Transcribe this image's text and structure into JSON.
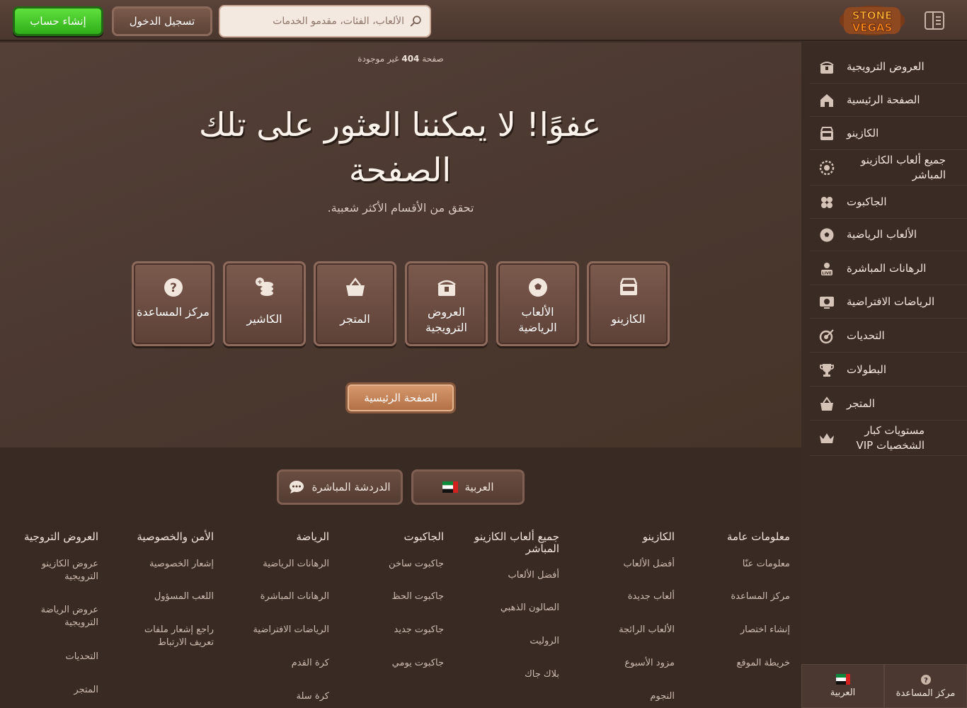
{
  "header": {
    "register_label": "إنشاء حساب",
    "login_label": "تسجيل الدخول",
    "search_placeholder": "الألعاب، الفئات، مقدمو الخدمات",
    "logo_top": "STONE",
    "logo_bottom": "VEGAS"
  },
  "sidebar": {
    "items": [
      {
        "label": "العروض الترويجية",
        "icon": "promotions-chest-icon"
      },
      {
        "label": "الصفحة الرئيسية",
        "icon": "home-icon"
      },
      {
        "label": "الكازينو",
        "icon": "casino-icon"
      },
      {
        "label": "جميع ألعاب الكازينو المباشر",
        "icon": "live-casino-chip-icon"
      },
      {
        "label": "الجاكبوت",
        "icon": "clover-icon"
      },
      {
        "label": "الألعاب الرياضية",
        "icon": "soccer-ball-icon"
      },
      {
        "label": "الرهانات المباشرة",
        "icon": "live-bet-icon"
      },
      {
        "label": "الرياضات الافتراضية",
        "icon": "virtual-sports-icon"
      },
      {
        "label": "التحديات",
        "icon": "target-icon"
      },
      {
        "label": "البطولات",
        "icon": "trophy-icon"
      },
      {
        "label": "المتجر",
        "icon": "basket-icon"
      },
      {
        "label": "مستويات كبار الشخصيات VIP",
        "icon": "crown-icon"
      }
    ],
    "bottom": {
      "language": "العربية",
      "help": "مركز المساعدة"
    }
  },
  "main": {
    "breadcrumb_prefix": "صفحة",
    "breadcrumb_code": "404",
    "breadcrumb_suffix": "غير موجودة",
    "title": "عفوًا! لا يمكننا العثور على تلك الصفحة",
    "subtitle": "تحقق من الأقسام الأكثر شعبية.",
    "cards": [
      {
        "label": "الكازينو",
        "icon": "casino-icon"
      },
      {
        "label": "الألعاب الرياضية",
        "icon": "soccer-ball-icon"
      },
      {
        "label": "العروض الترويجية",
        "icon": "promotions-chest-icon"
      },
      {
        "label": "المتجر",
        "icon": "basket-icon"
      },
      {
        "label": "الكاشير",
        "icon": "cashier-coins-icon"
      },
      {
        "label": "مركز المساعدة",
        "icon": "help-icon"
      }
    ],
    "home_button": "الصفحة الرئيسية"
  },
  "footer": {
    "language": "العربية",
    "live_chat": "الدردشة المباشرة",
    "columns": [
      {
        "heading": "معلومات عامة",
        "links": [
          "معلومات عنّا",
          "مركز المساعدة",
          "إنشاء اختصار",
          "خريطة الموقع"
        ]
      },
      {
        "heading": "الكازينو",
        "links": [
          "أفضل الألعاب",
          "ألعاب جديدة",
          "الألعاب الرائجة",
          "مزود الأسبوع",
          "النجوم"
        ]
      },
      {
        "heading": "جميع ألعاب الكازينو المباشر",
        "links": [
          "أفضل الألعاب",
          "الصالون الذهبي",
          "الروليت",
          "بلاك جاك"
        ]
      },
      {
        "heading": "الجاكبوت",
        "links": [
          "جاكبوت ساخن",
          "جاكبوت الحظ",
          "جاكبوت جديد",
          "جاكبوت يومي"
        ]
      },
      {
        "heading": "الرياضة",
        "links": [
          "الرهانات الرياضية",
          "الرهانات المباشرة",
          "الرياضات الافتراضية",
          "كرة القدم",
          "كرة سلة"
        ]
      },
      {
        "heading": "الأمن والخصوصية",
        "links": [
          "إشعار الخصوصية",
          "اللعب المسؤول",
          "راجع إشعار ملفات تعريف الارتباط"
        ]
      },
      {
        "heading": "العروض التروجية",
        "links": [
          "عروض الكازينو الترويجية",
          "عروض الرياضة الترويجية",
          "التحديات",
          "المتجر"
        ]
      }
    ]
  },
  "colors": {
    "accent_green": "#3cc424",
    "brand_orange": "#f08a1c",
    "background": "#3e2e27"
  }
}
